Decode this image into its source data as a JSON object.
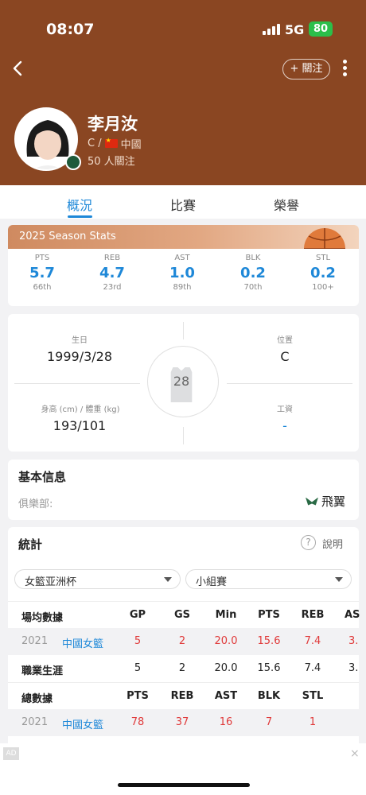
{
  "status": {
    "time": "08:07",
    "network": "5G",
    "battery": "80"
  },
  "header": {
    "follow_button": "+ 關注",
    "player_name": "李月汝",
    "position_prefix": "C /",
    "country": "中國",
    "followers": "50 人關注"
  },
  "tabs": [
    "概況",
    "比賽",
    "榮譽"
  ],
  "season": {
    "title": "2025 Season Stats",
    "stats": [
      {
        "label": "PTS",
        "value": "5.7",
        "rank": "66th"
      },
      {
        "label": "REB",
        "value": "4.7",
        "rank": "23rd"
      },
      {
        "label": "AST",
        "value": "1.0",
        "rank": "89th"
      },
      {
        "label": "BLK",
        "value": "0.2",
        "rank": "70th"
      },
      {
        "label": "STL",
        "value": "0.2",
        "rank": "100+"
      }
    ]
  },
  "bio": {
    "birthday_label": "生日",
    "birthday": "1999/3/28",
    "position_label": "位置",
    "position": "C",
    "size_label": "身高 (cm) / 體重 (kg)",
    "size": "193/101",
    "salary_label": "工資",
    "salary": "-",
    "jersey_number": "28"
  },
  "basic_info": {
    "title": "基本信息",
    "club_label": "俱樂部:",
    "club": "飛翼"
  },
  "stats_section": {
    "title": "統計",
    "help_label": "說明",
    "competition": "女籃亚洲杯",
    "stage": "小組賽",
    "avg_header": [
      "場均數據",
      "GP",
      "GS",
      "Min",
      "PTS",
      "REB",
      "AS"
    ],
    "avg_row": [
      "2021",
      "中國女籃",
      "5",
      "2",
      "20.0",
      "15.6",
      "7.4",
      "3."
    ],
    "career_row": [
      "職業生涯",
      "5",
      "2",
      "20.0",
      "15.6",
      "7.4",
      "3."
    ],
    "total_header": [
      "總數據",
      "PTS",
      "REB",
      "AST",
      "BLK",
      "STL"
    ],
    "total_row": [
      "2021",
      "中國女籃",
      "78",
      "37",
      "16",
      "7",
      "1"
    ]
  },
  "ad": {
    "tag": "AD",
    "close": "×"
  }
}
